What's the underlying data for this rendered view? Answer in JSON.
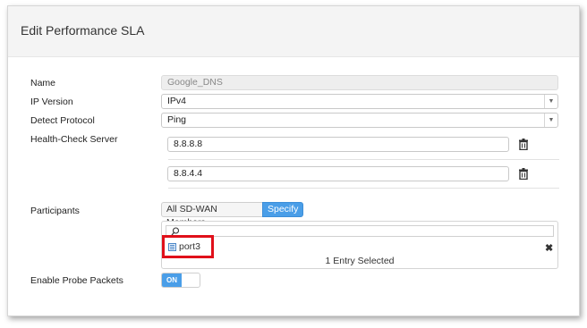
{
  "dialog": {
    "title": "Edit Performance SLA"
  },
  "form": {
    "name": {
      "label": "Name",
      "value": "Google_DNS"
    },
    "ip_version": {
      "label": "IP Version",
      "value": "IPv4"
    },
    "detect_protocol": {
      "label": "Detect Protocol",
      "value": "Ping"
    },
    "health_check": {
      "label": "Health-Check Server",
      "servers": [
        "8.8.8.8",
        "8.8.4.4"
      ]
    },
    "participants": {
      "label": "Participants",
      "options": [
        "All SD-WAN Members",
        "Specify"
      ],
      "selected_option": "Specify",
      "search_placeholder": "",
      "entries": [
        "port3"
      ],
      "count_text": "1 Entry Selected"
    },
    "probe_packets": {
      "label": "Enable Probe Packets",
      "toggle_text": "ON"
    }
  },
  "icons": {
    "trash": "trash-icon",
    "search": "search-icon",
    "port": "port-icon",
    "remove": "close-icon",
    "dropdown": "chevron-down-icon"
  },
  "colors": {
    "accent": "#4a9ee8",
    "highlight": "#e0101a"
  }
}
